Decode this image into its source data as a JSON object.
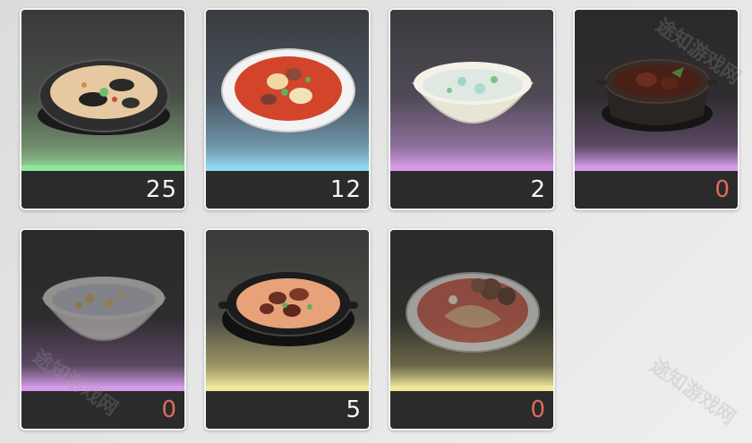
{
  "colors": {
    "green": "#8fe89a",
    "blue": "#8fd8f2",
    "purple": "#d59be8",
    "yellow": "#efe79a",
    "zero_count": "#e06a5d"
  },
  "dishes": [
    {
      "icon": "mussel-soup-bowl-icon",
      "count": "25",
      "rarity": "green"
    },
    {
      "icon": "tomato-stew-plate-icon",
      "count": "12",
      "rarity": "blue"
    },
    {
      "icon": "congee-bowl-icon",
      "count": "2",
      "rarity": "purple"
    },
    {
      "icon": "braised-meat-pot-icon",
      "count": "0",
      "rarity": "purple"
    },
    {
      "icon": "sweet-soup-bowl-icon",
      "count": "0",
      "rarity": "purple"
    },
    {
      "icon": "beef-curry-skillet-icon",
      "count": "5",
      "rarity": "yellow"
    },
    {
      "icon": "mushroom-platter-icon",
      "count": "0",
      "rarity": "yellow"
    }
  ],
  "watermark": "途知游戏网"
}
